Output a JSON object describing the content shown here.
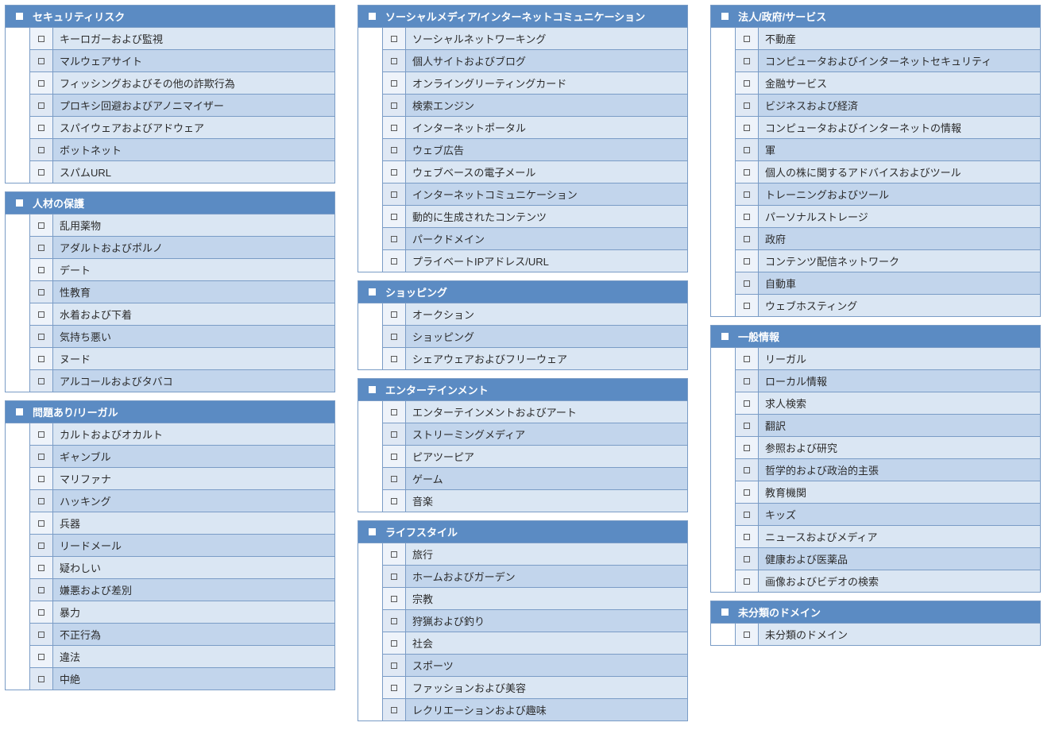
{
  "columns": [
    [
      {
        "title": "セキュリティリスク",
        "items": [
          "キーロガーおよび監視",
          "マルウェアサイト",
          "フィッシングおよびその他の詐欺行為",
          "プロキシ回避およびアノニマイザー",
          "スパイウェアおよびアドウェア",
          "ボットネット",
          "スパムURL"
        ]
      },
      {
        "title": "人材の保護",
        "items": [
          "乱用薬物",
          "アダルトおよびポルノ",
          "デート",
          "性教育",
          "水着および下着",
          "気持ち悪い",
          "ヌード",
          "アルコールおよびタバコ"
        ]
      },
      {
        "title": "問題あり/リーガル",
        "items": [
          "カルトおよびオカルト",
          "ギャンブル",
          "マリファナ",
          "ハッキング",
          "兵器",
          "リードメール",
          "疑わしい",
          "嫌悪および差別",
          "暴力",
          "不正行為",
          "違法",
          "中絶"
        ]
      }
    ],
    [
      {
        "title": "ソーシャルメディア/インターネットコミュニケーション",
        "items": [
          "ソーシャルネットワーキング",
          "個人サイトおよびブログ",
          "オンライングリーティングカード",
          "検索エンジン",
          "インターネットポータル",
          "ウェブ広告",
          "ウェブベースの電子メール",
          "インターネットコミュニケーション",
          "動的に生成されたコンテンツ",
          "パークドメイン",
          "プライベートIPアドレス/URL"
        ]
      },
      {
        "title": "ショッピング",
        "items": [
          "オークション",
          "ショッピング",
          "シェアウェアおよびフリーウェア"
        ]
      },
      {
        "title": "エンターテインメント",
        "items": [
          "エンターテインメントおよびアート",
          "ストリーミングメディア",
          "ピアツーピア",
          "ゲーム",
          "音楽"
        ]
      },
      {
        "title": "ライフスタイル",
        "items": [
          "旅行",
          "ホームおよびガーデン",
          "宗教",
          "狩猟および釣り",
          "社会",
          "スポーツ",
          "ファッションおよび美容",
          "レクリエーションおよび趣味"
        ]
      }
    ],
    [
      {
        "title": "法人/政府/サービス",
        "items": [
          "不動産",
          "コンピュータおよびインターネットセキュリティ",
          "金融サービス",
          "ビジネスおよび経済",
          "コンピュータおよびインターネットの情報",
          "軍",
          "個人の株に関するアドバイスおよびツール",
          "トレーニングおよびツール",
          "パーソナルストレージ",
          "政府",
          "コンテンツ配信ネットワーク",
          "自動車",
          "ウェブホスティング"
        ]
      },
      {
        "title": "一般情報",
        "items": [
          "リーガル",
          "ローカル情報",
          "求人検索",
          "翻訳",
          "参照および研究",
          "哲学的および政治的主張",
          "教育機関",
          "キッズ",
          "ニュースおよびメディア",
          "健康および医薬品",
          "画像およびビデオの検索"
        ]
      },
      {
        "title": "未分類のドメイン",
        "items": [
          "未分類のドメイン"
        ]
      }
    ]
  ]
}
